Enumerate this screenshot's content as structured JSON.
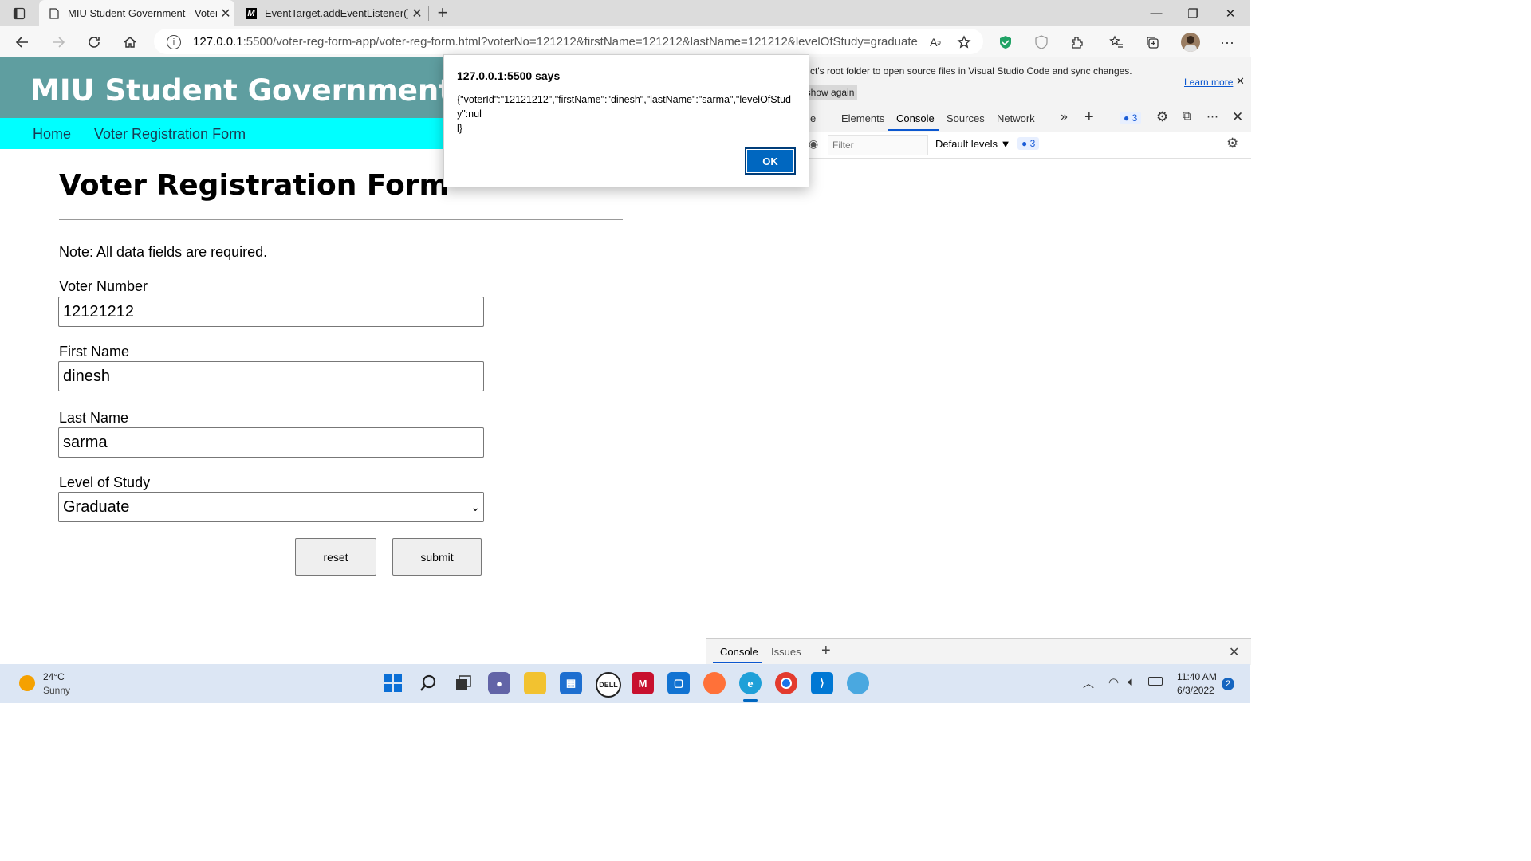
{
  "browser": {
    "tabs": [
      {
        "title": "MIU Student Government - Voter",
        "favicon": "page-icon",
        "active": true
      },
      {
        "title": "EventTarget.addEventListener() -",
        "favicon": "mdn-icon",
        "favicon_text": "M",
        "active": false
      }
    ],
    "new_tab": "+",
    "url_host": "127.0.0.1",
    "url_rest": ":5500/voter-reg-form-app/voter-reg-form.html?voterNo=121212&firstName=121212&lastName=121212&levelOfStudy=graduate"
  },
  "site": {
    "title": "MIU Student Government",
    "nav": [
      "Home",
      "Voter Registration Form"
    ],
    "header_color": "#5f9ea0",
    "nav_color": "#00ffff"
  },
  "form": {
    "heading": "Voter Registration Form",
    "note": "Note: All data fields are required.",
    "voter_number_label": "Voter Number",
    "voter_number_value": "12121212",
    "first_name_label": "First Name",
    "first_name_value": "dinesh",
    "last_name_label": "Last Name",
    "last_name_value": "sarma",
    "level_label": "Level of Study",
    "level_value": "Graduate",
    "reset_label": "reset",
    "submit_label": "submit"
  },
  "alert": {
    "title": "127.0.0.1:5500 says",
    "message": "{\"voterId\":\"12121212\",\"firstName\":\"dinesh\",\"lastName\":\"sarma\",\"levelOfStudy\":nul\nl}",
    "ok_label": "OK"
  },
  "devtools": {
    "info_text": "ct's root folder to open source files in Visual Studio Code and sync changes.",
    "dont_show": "t show again",
    "learn_more": "Learn more",
    "tab_partial": "e",
    "tabs": [
      "Elements",
      "Console",
      "Sources",
      "Network"
    ],
    "issues_count": "3",
    "filter_placeholder": "Filter",
    "levels": "Default levels",
    "drawer_tabs": [
      "Console",
      "Issues"
    ]
  },
  "taskbar": {
    "temperature": "24°C",
    "weather": "Sunny",
    "time": "11:40 AM",
    "date": "6/3/2022",
    "notifications": "2"
  }
}
